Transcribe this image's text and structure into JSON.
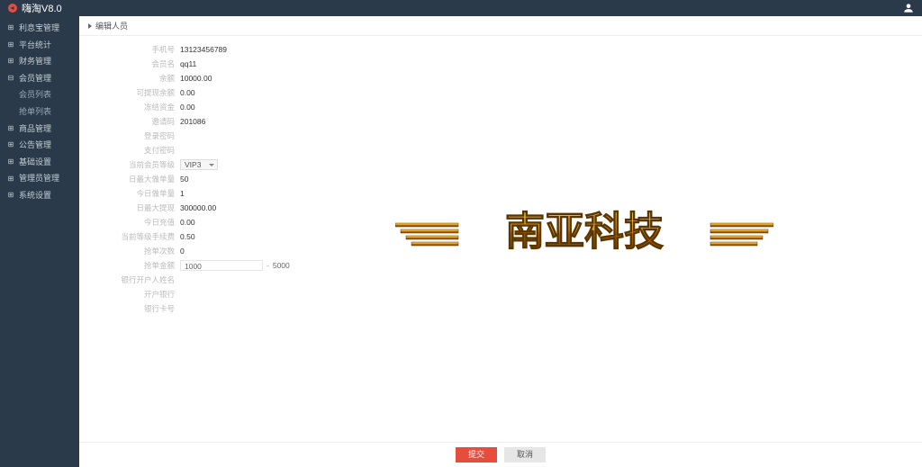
{
  "brand": "嗨淘V8.0",
  "sidebar": {
    "items": [
      {
        "label": "利息宝管理"
      },
      {
        "label": "平台统计"
      },
      {
        "label": "财务管理"
      },
      {
        "label": "会员管理",
        "children": [
          {
            "label": "会员列表"
          },
          {
            "label": "抢单列表"
          }
        ]
      },
      {
        "label": "商品管理"
      },
      {
        "label": "公告管理"
      },
      {
        "label": "基础设置"
      },
      {
        "label": "管理员管理"
      },
      {
        "label": "系统设置"
      }
    ]
  },
  "page": {
    "title": "编辑人员"
  },
  "form": {
    "phone": {
      "label": "手机号",
      "value": "13123456789"
    },
    "member_name": {
      "label": "会员名",
      "value": "qq11"
    },
    "balance": {
      "label": "余额",
      "value": "10000.00"
    },
    "withdrawable": {
      "label": "可提现余额",
      "value": "0.00"
    },
    "frozen": {
      "label": "冻结资金",
      "value": "0.00"
    },
    "invite_code": {
      "label": "邀请码",
      "value": "201086"
    },
    "login_pwd": {
      "label": "登录密码",
      "value": ""
    },
    "pay_pwd": {
      "label": "支付密码",
      "value": ""
    },
    "vip_level": {
      "label": "当前会员等级",
      "value": "VIP3"
    },
    "daily_max_orders": {
      "label": "日最大做单量",
      "value": "50"
    },
    "today_orders": {
      "label": "今日做单量",
      "value": "1"
    },
    "daily_max_withdraw": {
      "label": "日最大提现",
      "value": "300000.00"
    },
    "today_withdraw": {
      "label": "今日充值",
      "value": "0.00"
    },
    "commission_rate": {
      "label": "当前等级手续费",
      "value": "0.50"
    },
    "order_count": {
      "label": "抢单次数",
      "value": "0"
    },
    "order_amount": {
      "label": "抢单金额",
      "min": "1000",
      "max": "5000"
    },
    "acct_name": {
      "label": "银行开户人姓名",
      "value": ""
    },
    "acct_bank": {
      "label": "开户银行",
      "value": ""
    },
    "bank_card": {
      "label": "银行卡号",
      "value": ""
    }
  },
  "watermark_text": "南亚科技",
  "footer": {
    "submit": "提交",
    "cancel": "取消"
  }
}
